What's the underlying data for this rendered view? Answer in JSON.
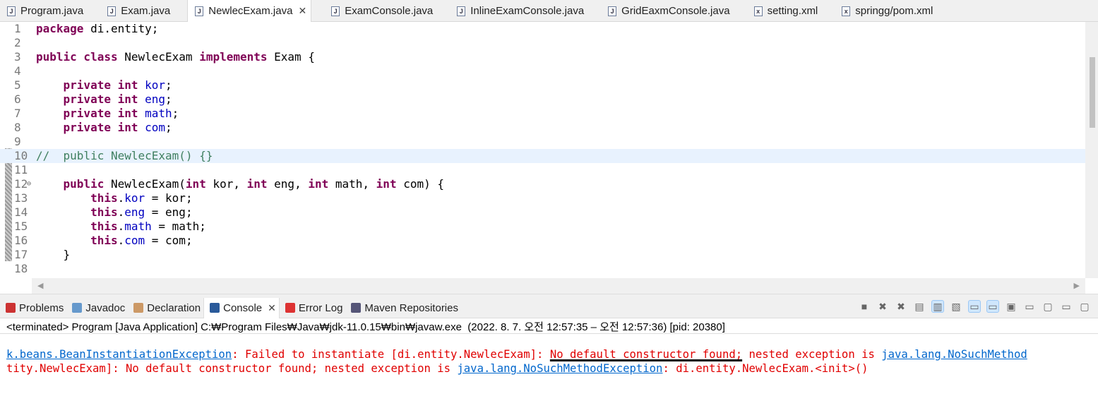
{
  "editor_tabs": [
    {
      "label": "Program.java"
    },
    {
      "label": "Exam.java"
    },
    {
      "label": "NewlecExam.java",
      "active": true,
      "close": "✕"
    },
    {
      "label": "ExamConsole.java"
    },
    {
      "label": "InlineExamConsole.java"
    },
    {
      "label": "GridEaxmConsole.java"
    },
    {
      "label": "setting.xml"
    },
    {
      "label": "springg/pom.xml"
    }
  ],
  "code_lines": [
    {
      "n": "1",
      "seg": [
        [
          "kw",
          "package"
        ],
        [
          "pl",
          " di.entity;"
        ]
      ]
    },
    {
      "n": "2",
      "seg": []
    },
    {
      "n": "3",
      "seg": [
        [
          "kw",
          "public class"
        ],
        [
          "pl",
          " NewlecExam "
        ],
        [
          "kw",
          "implements"
        ],
        [
          "pl",
          " Exam {"
        ]
      ]
    },
    {
      "n": "4",
      "seg": []
    },
    {
      "n": "5",
      "seg": [
        [
          "pl",
          "    "
        ],
        [
          "kw",
          "private int"
        ],
        [
          "fld",
          " kor"
        ],
        [
          "pl",
          ";"
        ]
      ]
    },
    {
      "n": "6",
      "seg": [
        [
          "pl",
          "    "
        ],
        [
          "kw",
          "private int"
        ],
        [
          "fld",
          " eng"
        ],
        [
          "pl",
          ";"
        ]
      ]
    },
    {
      "n": "7",
      "seg": [
        [
          "pl",
          "    "
        ],
        [
          "kw",
          "private int"
        ],
        [
          "fld",
          " math"
        ],
        [
          "pl",
          ";"
        ]
      ]
    },
    {
      "n": "8",
      "seg": [
        [
          "pl",
          "    "
        ],
        [
          "kw",
          "private int"
        ],
        [
          "fld",
          " com"
        ],
        [
          "pl",
          ";"
        ]
      ]
    },
    {
      "n": "9",
      "seg": []
    },
    {
      "n": "10",
      "seg": [
        [
          "cm",
          "//  public NewlecExam() {}"
        ]
      ],
      "current": true
    },
    {
      "n": "11",
      "seg": []
    },
    {
      "n": "12",
      "seg": [
        [
          "pl",
          "    "
        ],
        [
          "kw",
          "public"
        ],
        [
          "pl",
          " NewlecExam("
        ],
        [
          "kw",
          "int"
        ],
        [
          "pl",
          " kor, "
        ],
        [
          "kw",
          "int"
        ],
        [
          "pl",
          " eng, "
        ],
        [
          "kw",
          "int"
        ],
        [
          "pl",
          " math, "
        ],
        [
          "kw",
          "int"
        ],
        [
          "pl",
          " com) {"
        ]
      ]
    },
    {
      "n": "13",
      "seg": [
        [
          "pl",
          "        "
        ],
        [
          "kw",
          "this"
        ],
        [
          "pl",
          "."
        ],
        [
          "fld",
          "kor"
        ],
        [
          "pl",
          " = kor;"
        ]
      ]
    },
    {
      "n": "14",
      "seg": [
        [
          "pl",
          "        "
        ],
        [
          "kw",
          "this"
        ],
        [
          "pl",
          "."
        ],
        [
          "fld",
          "eng"
        ],
        [
          "pl",
          " = eng;"
        ]
      ]
    },
    {
      "n": "15",
      "seg": [
        [
          "pl",
          "        "
        ],
        [
          "kw",
          "this"
        ],
        [
          "pl",
          "."
        ],
        [
          "fld",
          "math"
        ],
        [
          "pl",
          " = math;"
        ]
      ]
    },
    {
      "n": "16",
      "seg": [
        [
          "pl",
          "        "
        ],
        [
          "kw",
          "this"
        ],
        [
          "pl",
          "."
        ],
        [
          "fld",
          "com"
        ],
        [
          "pl",
          " = com;"
        ]
      ]
    },
    {
      "n": "17",
      "seg": [
        [
          "pl",
          "    }"
        ]
      ]
    },
    {
      "n": "18",
      "seg": []
    }
  ],
  "console_tabs": [
    {
      "label": "Problems",
      "color": "#c33"
    },
    {
      "label": "Javadoc",
      "color": "#69c"
    },
    {
      "label": "Declaration",
      "color": "#c96"
    },
    {
      "label": "Console",
      "active": true,
      "close": "✕",
      "color": "#2a5a9a"
    },
    {
      "label": "Error Log",
      "color": "#d33"
    },
    {
      "label": "Maven Repositories",
      "color": "#557"
    }
  ],
  "console": {
    "status": "<terminated> Program [Java Application] C:₩Program Files₩Java₩jdk-11.0.15₩bin₩javaw.exe  (2022. 8. 7. 오전 12:57:35 – 오전 12:57:36) [pid: 20380]",
    "line1": [
      [
        "lnk",
        "k.beans.BeanInstantiationException"
      ],
      [
        "",
        ": Failed to instantiate [di.entity.NewlecExam]: "
      ],
      [
        "ul",
        "No default constructor found;"
      ],
      [
        "",
        " nested exception is "
      ],
      [
        "lnk",
        "java.lang.NoSuchMethod"
      ]
    ],
    "line2": [
      [
        "",
        "tity.NewlecExam]: No default constructor found; nested exception is "
      ],
      [
        "lnk",
        "java.lang.NoSuchMethodException"
      ],
      [
        "",
        ": di.entity.NewlecExam.<init>()"
      ]
    ]
  },
  "toolbar_icons": [
    "terminate-icon",
    "remove-launch-icon",
    "remove-all-icon",
    "clear-console-icon",
    "scroll-lock-icon",
    "word-wrap-icon",
    "show-on-stdout-icon",
    "show-on-stderr-icon",
    "pin-console-icon",
    "display-console-icon",
    "open-console-icon",
    "minimize-icon",
    "maximize-icon"
  ]
}
